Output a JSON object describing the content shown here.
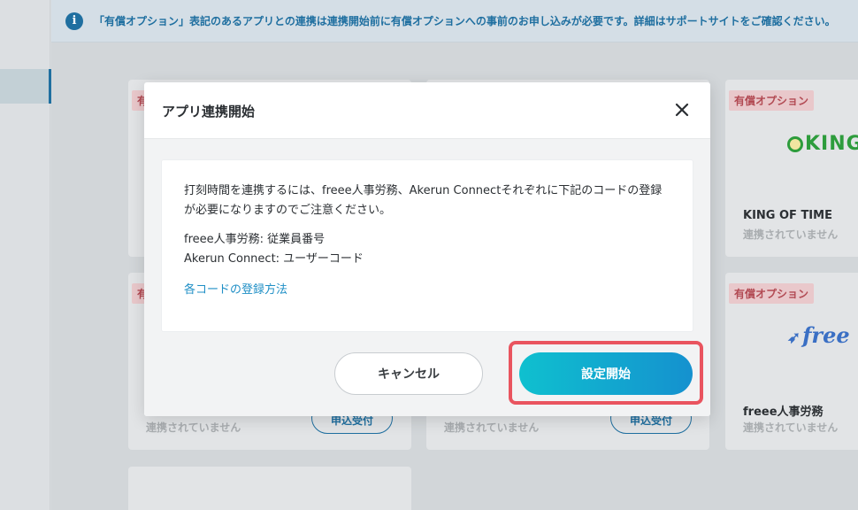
{
  "notice": {
    "text": "「有償オプション」表記のあるアプリとの連携は連携開始前に有償オプションへの事前のお申し込みが必要です。詳細はサポートサイトをご確認ください。",
    "icon": "info-icon"
  },
  "cards": {
    "paid_badge": "有償オプション",
    "status_not_connected": "連携されていません",
    "apply_label": "申込受付",
    "king_of_time": {
      "logo_text": "KING",
      "name": "KING OF TIME"
    },
    "freee": {
      "logo_text": "free",
      "name": "freee人事労務"
    }
  },
  "modal": {
    "title": "アプリ連携開始",
    "paragraph": "打刻時間を連携するには、freee人事労務、Akerun Connectそれぞれに下記のコードの登録が必要になりますのでご注意ください。",
    "code_freee": "freee人事労務: 従業員番号",
    "code_akerun": "Akerun Connect: ユーザーコード",
    "help_link": "各コードの登録方法",
    "cancel_label": "キャンセル",
    "start_label": "設定開始"
  },
  "colors": {
    "accent": "#1f6fa0",
    "link": "#1f8fc6",
    "highlight": "#e9545f",
    "badge_text": "#b24a53"
  }
}
